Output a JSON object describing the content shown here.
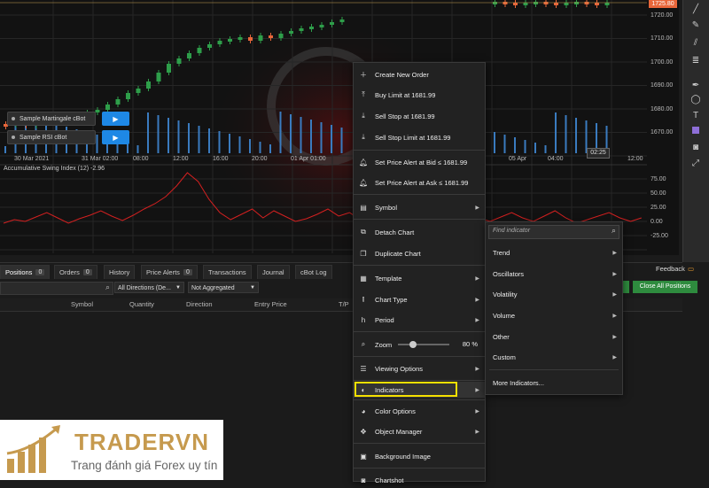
{
  "chart": {
    "price_ticks": [
      "1720.00",
      "1710.00",
      "1700.00",
      "1690.00",
      "1680.00",
      "1670.00"
    ],
    "current_price": "1725.80",
    "time_ticks": [
      "30 Mar 2021",
      "31 Mar 02:00",
      "08:00",
      "12:00",
      "16:00",
      "20:00",
      "01 Apr 01:00",
      "05 Apr",
      "04:00",
      "08:00",
      "12:00"
    ],
    "crosshair_time": "02:25",
    "oscillator_title": "Accumulative Swing Index (12) -2.96",
    "osc_ticks": [
      "75.00",
      "50.00",
      "25.00",
      "0.00",
      "-25.00"
    ],
    "accent_up": "#2e9e4a",
    "accent_down": "#e8663a"
  },
  "bots": [
    {
      "label": "Sample Martingale cBot",
      "play": "▶"
    },
    {
      "label": "Sample RSI cBot",
      "play": "▶"
    }
  ],
  "toolbar_icons": [
    "trend-line",
    "pencil",
    "ruler",
    "fibonacci",
    "pen",
    "text",
    "rectangle",
    "camera",
    "expand"
  ],
  "tabs": [
    {
      "label": "Positions",
      "count": "0",
      "active": true
    },
    {
      "label": "Orders",
      "count": "0"
    },
    {
      "label": "History"
    },
    {
      "label": "Price Alerts",
      "count": "0"
    },
    {
      "label": "Transactions"
    },
    {
      "label": "Journal"
    },
    {
      "label": "cBot Log"
    }
  ],
  "feedback": "Feedback",
  "filters": {
    "direction": "All Directions (De...",
    "aggregation": "Not Aggregated"
  },
  "columns": [
    "Symbol",
    "Quantity",
    "Direction",
    "Entry Price",
    "T/P"
  ],
  "close_all": "Close All Positions",
  "context_menu": {
    "items": {
      "create_order": "Create New Order",
      "buy_limit": "Buy Limit at 1681.99",
      "sell_stop": "Sell Stop at 1681.99",
      "sell_stop_limit": "Sell Stop Limit at 1681.99",
      "alert_bid": "Set Price Alert at Bid ≤ 1681.99",
      "alert_ask": "Set Price Alert at Ask ≤ 1681.99",
      "symbol": "Symbol",
      "detach": "Detach Chart",
      "duplicate": "Duplicate Chart",
      "template": "Template",
      "chart_type": "Chart Type",
      "period": "Period",
      "zoom": "Zoom",
      "zoom_value": "80 %",
      "viewing": "Viewing Options",
      "indicators": "Indicators",
      "color_options": "Color Options",
      "object_manager": "Object Manager",
      "background": "Background Image",
      "chartshot": "Chartshot"
    },
    "zoom_level": 0.25,
    "highlight_color": "#f5e000"
  },
  "submenu": {
    "search_placeholder": "Find indicator",
    "items": [
      "Trend",
      "Oscillators",
      "Volatility",
      "Volume",
      "Other",
      "Custom"
    ],
    "more": "More Indicators..."
  },
  "logo": {
    "brand": "TRADERVN",
    "tagline": "Trang đánh giá Forex uy tín"
  }
}
